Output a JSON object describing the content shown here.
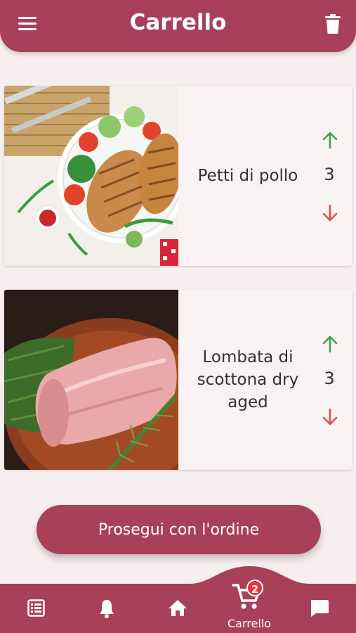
{
  "header": {
    "title": "Carrello",
    "menu_icon": "menu-icon",
    "trash_icon": "trash-icon"
  },
  "cart": {
    "items": [
      {
        "name": "Petti di pollo",
        "quantity": "3",
        "image": "grilled-chicken-breast-salad"
      },
      {
        "name": "Lombata di scottona dry aged",
        "quantity": "3",
        "image": "raw-beef-loin-with-herbs"
      }
    ]
  },
  "proceed_button": {
    "label": "Prosegui con l'ordine"
  },
  "bottom_nav": {
    "items": [
      {
        "icon": "list-icon",
        "label": ""
      },
      {
        "icon": "bell-icon",
        "label": ""
      },
      {
        "icon": "home-icon",
        "label": ""
      },
      {
        "icon": "cart-icon",
        "label": "Carrello",
        "badge": "2",
        "active": true
      },
      {
        "icon": "chat-icon",
        "label": ""
      }
    ]
  },
  "colors": {
    "primary": "#a8405a",
    "background": "#f7efef",
    "arrow_up": "#3ea34a",
    "arrow_down": "#d9534f",
    "badge": "#e8323f"
  }
}
